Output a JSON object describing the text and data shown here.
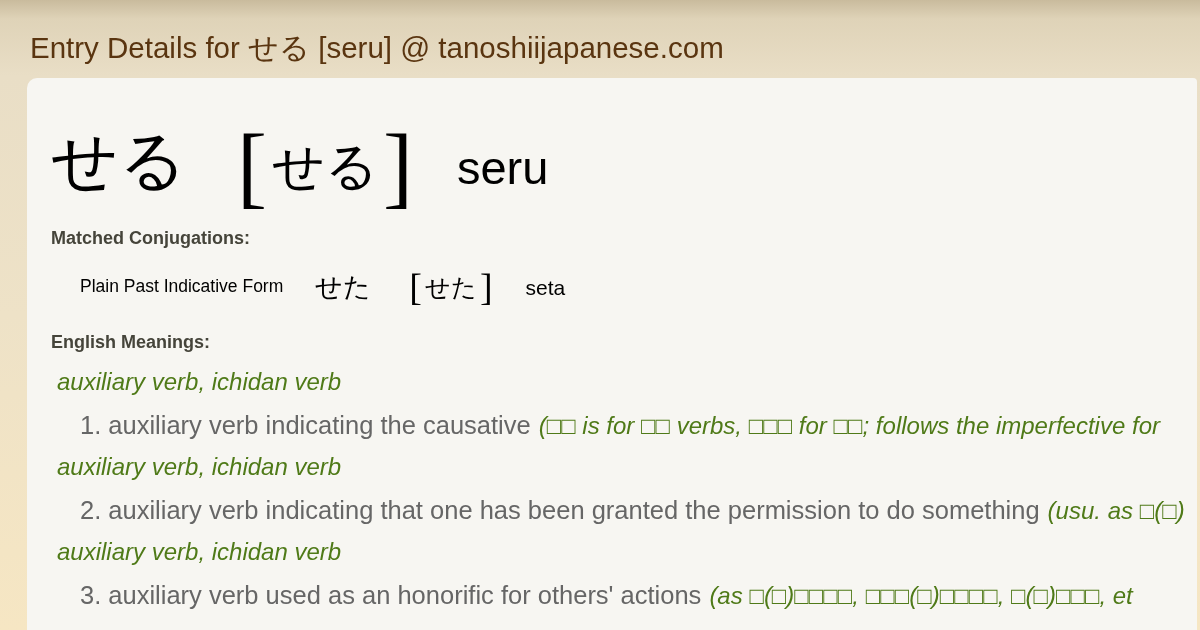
{
  "page_title": "Entry Details for せる [seru] @ tanoshiijapanese.com",
  "entry": {
    "word": "せる",
    "brackets": [
      "[",
      "]"
    ],
    "reading": "せる",
    "romaji": "seru"
  },
  "matched_conjugations": {
    "heading": "Matched Conjugations:",
    "items": [
      {
        "form": "Plain Past Indicative Form",
        "word": "せた",
        "brackets": [
          "[",
          "]"
        ],
        "reading": "せた",
        "romaji": "seta"
      }
    ]
  },
  "english_meanings": {
    "heading": "English Meanings:",
    "senses": [
      {
        "part_of_speech": "auxiliary verb, ichidan verb",
        "number": "1.",
        "gloss": "auxiliary verb indicating the causative",
        "note": "(□□ is for □□ verbs, □□□ for □□; follows the imperfective for"
      },
      {
        "part_of_speech": "auxiliary verb, ichidan verb",
        "number": "2.",
        "gloss": "auxiliary verb indicating that one has been granted the permission to do something",
        "note": "(usu. as □(□)"
      },
      {
        "part_of_speech": "auxiliary verb, ichidan verb",
        "number": "3.",
        "gloss": "auxiliary verb used as an honorific for others' actions",
        "note": "(as □(□)□□□□, □□□(□)□□□□, □(□)□□□, et"
      }
    ]
  }
}
